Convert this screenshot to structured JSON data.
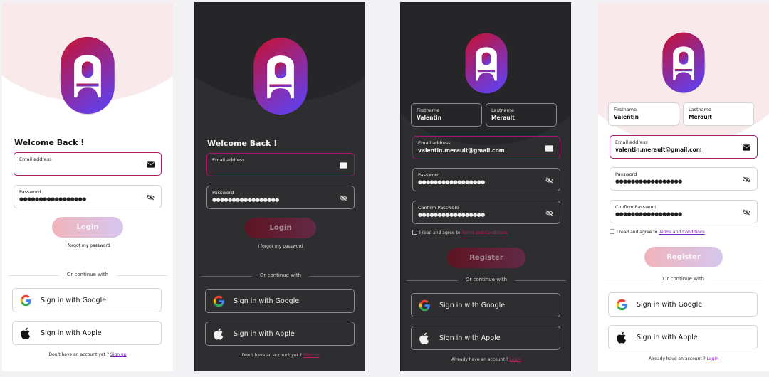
{
  "login": {
    "heading": "Welcome Back !",
    "email_label": "Email address",
    "password_label": "Password",
    "password_mask": "●●●●●●●●●●●●●●●●●",
    "login_button": "Login",
    "forgot": "I forgot my password",
    "continue": "Or continue with",
    "google": "Sign in with Google",
    "apple": "Sign in with Apple",
    "footer_prefix": "Don't have an account yet ? ",
    "footer_link": "Sign up"
  },
  "register": {
    "firstname_label": "Firstname",
    "firstname_value": "Valentin",
    "lastname_label": "Lastname",
    "lastname_value": "Merault",
    "email_label": "Email address",
    "email_value": "valentin.merault@gmail.com",
    "password_label": "Password",
    "confirm_label": "Confirm Password",
    "password_mask": "●●●●●●●●●●●●●●●●●",
    "terms_prefix": "I read and agree to ",
    "terms_link": "Terms and Conditions",
    "register_button": "Register",
    "continue": "Or continue with",
    "google": "Sign in with Google",
    "apple": "Sign in with Apple",
    "footer_prefix": "Already have an account ? ",
    "footer_link": "Login"
  },
  "icons": {
    "logo": "app-logo",
    "mail": "mail-icon",
    "password_toggle": "eye-off-icon",
    "google": "google-icon",
    "apple": "apple-icon",
    "checkbox": "checkbox-icon"
  },
  "colors": {
    "brand_red": "#c8102e",
    "brand_purple": "#6a3ce0",
    "focus_border": "#a41a6e",
    "link_light": "#7a1fb8",
    "link_dark": "#b81e5a"
  }
}
